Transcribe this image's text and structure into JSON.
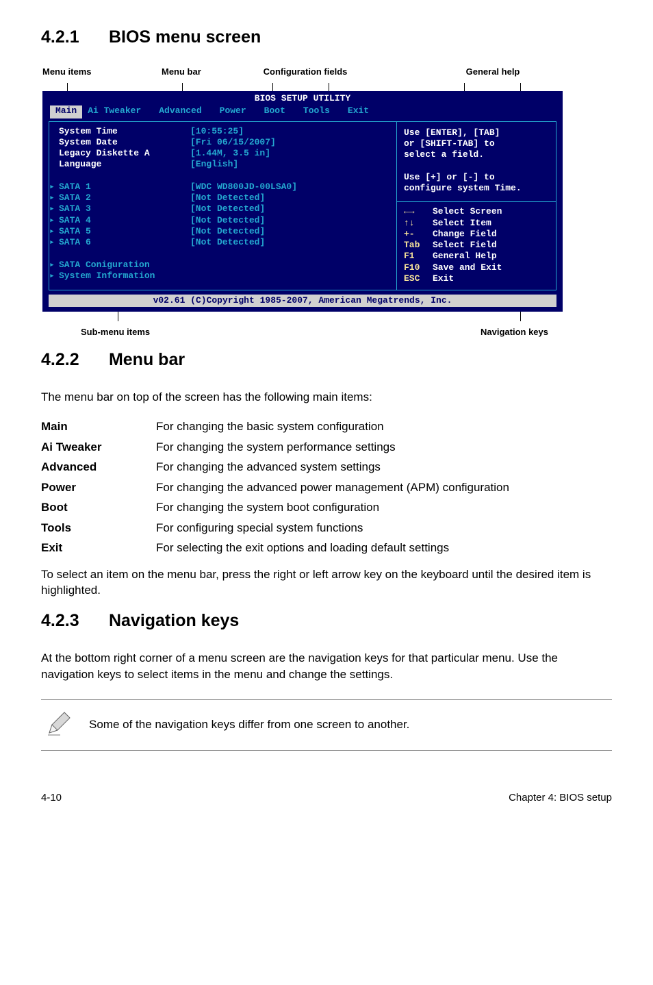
{
  "sections": {
    "s421": {
      "num": "4.2.1",
      "title": "BIOS menu screen"
    },
    "s422": {
      "num": "4.2.2",
      "title": "Menu bar"
    },
    "s423": {
      "num": "4.2.3",
      "title": "Navigation keys"
    }
  },
  "top_annotations": {
    "menu_items": "Menu items",
    "menu_bar": "Menu bar",
    "config_fields": "Configuration fields",
    "general_help": "General help"
  },
  "bios": {
    "title": "BIOS SETUP UTILITY",
    "tabs": [
      "Main",
      "Ai Tweaker",
      "Advanced",
      "Power",
      "Boot",
      "Tools",
      "Exit"
    ],
    "left_rows": [
      {
        "k": "System Time",
        "v": "[10:55:25]",
        "kind": "white"
      },
      {
        "k": "System Date",
        "v": "[Fri 06/15/2007]",
        "kind": "white"
      },
      {
        "k": "Legacy Diskette A",
        "v": "[1.44M, 3.5 in]",
        "kind": "white"
      },
      {
        "k": "Language",
        "v": "[English]",
        "kind": "white"
      },
      {
        "k": "",
        "v": "",
        "kind": "gap"
      },
      {
        "k": "SATA 1",
        "v": "[WDC WD800JD-00LSA0]",
        "kind": "sub"
      },
      {
        "k": "SATA 2",
        "v": "[Not Detected]",
        "kind": "sub"
      },
      {
        "k": "SATA 3",
        "v": "[Not Detected]",
        "kind": "sub"
      },
      {
        "k": "SATA 4",
        "v": "[Not Detected]",
        "kind": "sub"
      },
      {
        "k": "SATA 5",
        "v": "[Not Detected]",
        "kind": "sub"
      },
      {
        "k": "SATA 6",
        "v": "[Not Detected]",
        "kind": "sub"
      },
      {
        "k": "",
        "v": "",
        "kind": "gap"
      },
      {
        "k": "SATA Coniguration",
        "v": "",
        "kind": "sub"
      },
      {
        "k": "System Information",
        "v": "",
        "kind": "sub"
      }
    ],
    "help_lines": [
      "Use [ENTER], [TAB]",
      "or [SHIFT-TAB] to",
      "select a field.",
      "",
      "Use [+] or [-] to",
      "configure system Time."
    ],
    "nav_keys": [
      {
        "k": "←→",
        "v": "Select Screen",
        "arrow": true
      },
      {
        "k": "↑↓",
        "v": "Select Item",
        "arrow": true
      },
      {
        "k": "+-",
        "v": "Change Field"
      },
      {
        "k": "Tab",
        "v": "Select Field"
      },
      {
        "k": "F1",
        "v": "General Help"
      },
      {
        "k": "F10",
        "v": "Save and Exit"
      },
      {
        "k": "ESC",
        "v": "Exit"
      }
    ],
    "copyright": "v02.61 (C)Copyright 1985-2007, American Megatrends, Inc."
  },
  "bottom_annotations": {
    "sub_menu": "Sub-menu items",
    "nav_keys": "Navigation keys"
  },
  "s422_intro": "The menu bar on top of the screen has the following main items:",
  "defs": [
    {
      "k": "Main",
      "v": "For changing the basic system configuration"
    },
    {
      "k": "Ai Tweaker",
      "v": "For changing the system performance settings"
    },
    {
      "k": "Advanced",
      "v": "For changing the advanced system settings"
    },
    {
      "k": "Power",
      "v": "For changing the advanced power management (APM) configuration"
    },
    {
      "k": "Boot",
      "v": "For changing the system boot configuration"
    },
    {
      "k": "Tools",
      "v": "For configuring special system functions"
    },
    {
      "k": "Exit",
      "v": "For selecting the exit options and loading default settings"
    }
  ],
  "s422_outro": "To select an item on the menu bar, press the right or left arrow key on the keyboard until the desired item is highlighted.",
  "s423_body": "At the bottom right corner of a menu screen are the navigation keys for that particular menu. Use the navigation keys to select items in the menu and change the settings.",
  "note_text": "Some of the navigation keys differ from one screen to another.",
  "footer": {
    "left": "4-10",
    "right": "Chapter 4: BIOS setup"
  }
}
